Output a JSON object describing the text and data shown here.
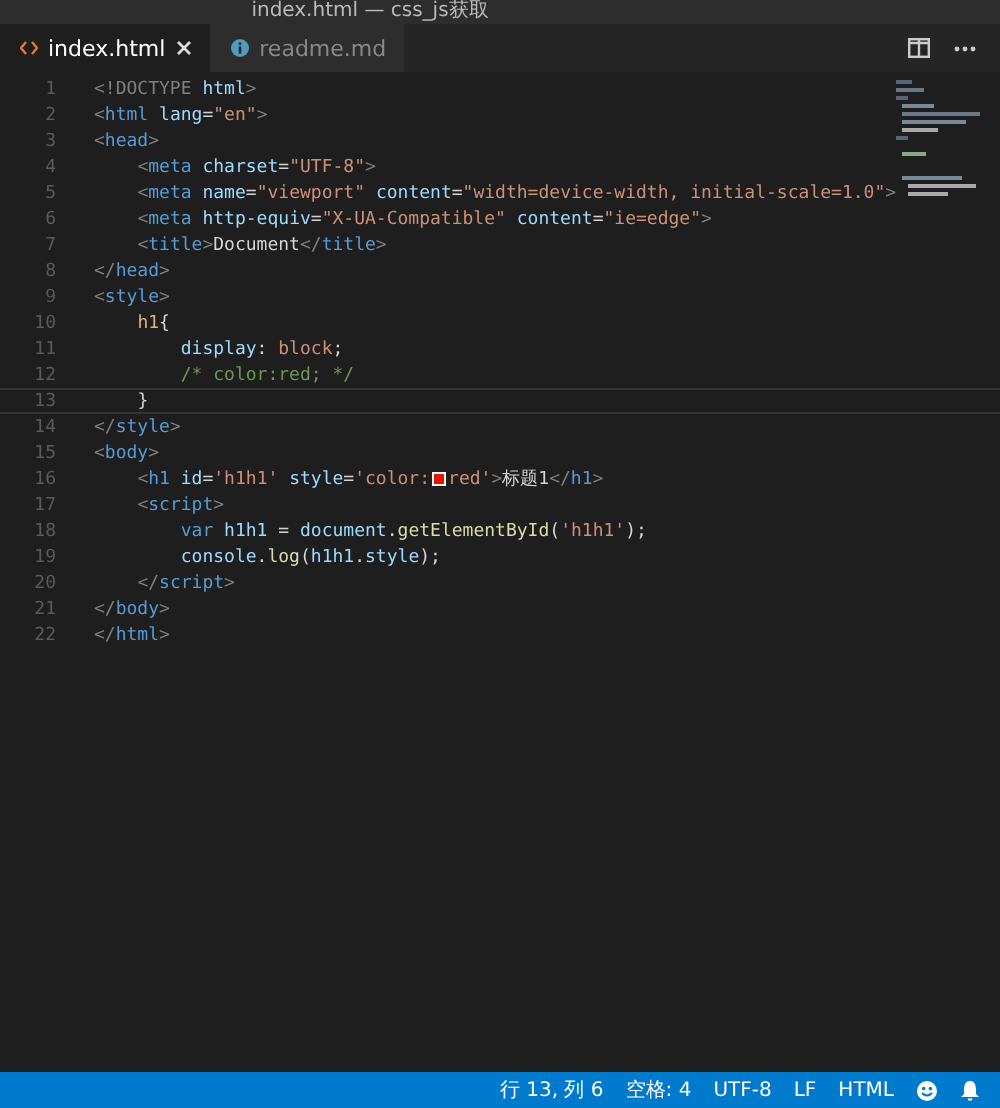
{
  "window": {
    "title": "index.html — css_js获取"
  },
  "tabs": [
    {
      "label": "index.html",
      "selected": true,
      "kind": "html"
    },
    {
      "label": "readme.md",
      "selected": false,
      "kind": "info"
    }
  ],
  "editor": {
    "lines": [
      {
        "number": "1",
        "current": false,
        "kind": "html",
        "text": "<!DOCTYPE html>"
      },
      {
        "number": "2",
        "current": false,
        "kind": "html",
        "text": "<html lang=\"en\">"
      },
      {
        "number": "3",
        "current": false,
        "kind": "html",
        "text": "<head>"
      },
      {
        "number": "4",
        "current": false,
        "kind": "html",
        "text": "    <meta charset=\"UTF-8\">"
      },
      {
        "number": "5",
        "current": false,
        "kind": "html",
        "text": "    <meta name=\"viewport\" content=\"width=device-width, initial-scale=1.0\">"
      },
      {
        "number": "6",
        "current": false,
        "kind": "html",
        "text": "    <meta http-equiv=\"X-UA-Compatible\" content=\"ie=edge\">"
      },
      {
        "number": "7",
        "current": false,
        "kind": "html",
        "text": "    <title>Document</title>"
      },
      {
        "number": "8",
        "current": false,
        "kind": "html",
        "text": "</head>"
      },
      {
        "number": "9",
        "current": false,
        "kind": "html",
        "text": "<style>"
      },
      {
        "number": "10",
        "current": false,
        "kind": "css",
        "text": "    h1{"
      },
      {
        "number": "11",
        "current": false,
        "kind": "css",
        "text": "        display: block;"
      },
      {
        "number": "12",
        "current": false,
        "kind": "css",
        "text": "        /* color:red; */"
      },
      {
        "number": "13",
        "current": true,
        "kind": "css",
        "text": "    }"
      },
      {
        "number": "14",
        "current": false,
        "kind": "html",
        "text": "</style>"
      },
      {
        "number": "15",
        "current": false,
        "kind": "html",
        "text": "<body>"
      },
      {
        "number": "16",
        "current": false,
        "kind": "html",
        "text": "    <h1 id='h1h1' style='color:",
        "swatch": {
          "color": "#e51400"
        },
        "after_swatch": "red'>标题1</h1>"
      },
      {
        "number": "17",
        "current": false,
        "kind": "html",
        "text": "    <script>"
      },
      {
        "number": "18",
        "current": false,
        "kind": "js",
        "text": "        var h1h1 = document.getElementById('h1h1');"
      },
      {
        "number": "19",
        "current": false,
        "kind": "js",
        "text": "        console.log(h1h1.style);"
      },
      {
        "number": "20",
        "current": false,
        "kind": "html",
        "text": "    </script>"
      },
      {
        "number": "21",
        "current": false,
        "kind": "html",
        "text": "</body>"
      },
      {
        "number": "22",
        "current": false,
        "kind": "html",
        "text": "</html>"
      }
    ]
  },
  "status_bar": {
    "items": [
      "行 13, 列 6",
      "空格: 4",
      "UTF-8",
      "LF",
      "HTML"
    ]
  }
}
